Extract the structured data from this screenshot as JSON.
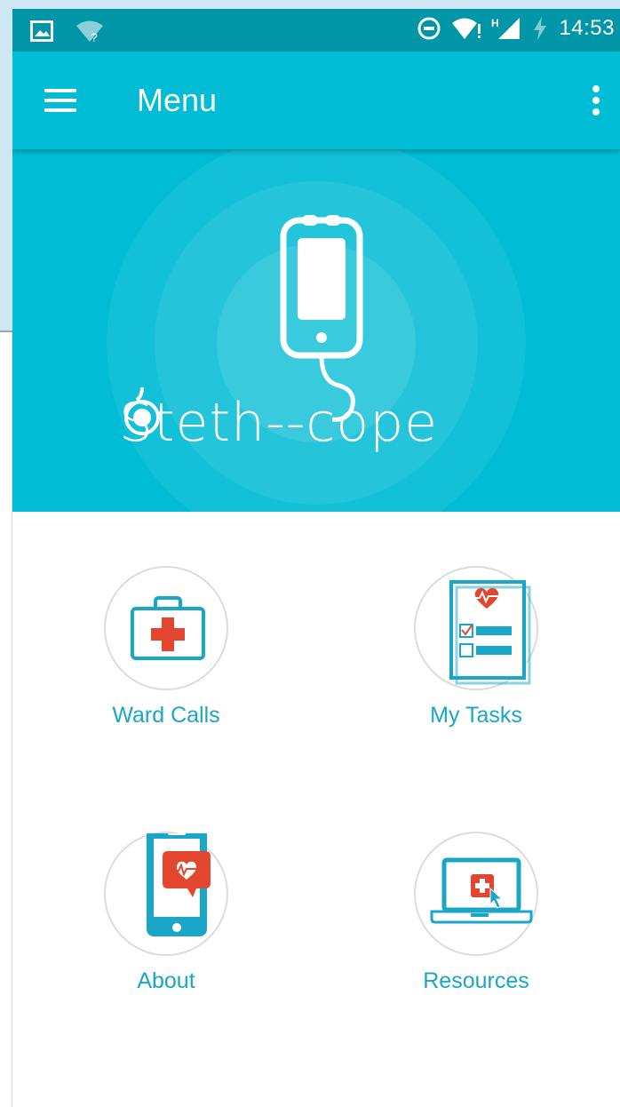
{
  "status_bar": {
    "time": "14:53",
    "icons": [
      "image-icon",
      "wifi-unknown-icon",
      "do-not-disturb-icon",
      "wifi-alert-icon",
      "signal-h-icon",
      "battery-charging-icon"
    ]
  },
  "app_bar": {
    "title": "Menu",
    "icons": [
      "hamburger-menu-icon",
      "overflow-menu-icon"
    ]
  },
  "hero": {
    "logo_text_before": "Steth-",
    "logo_text_after": "-cope"
  },
  "menu": {
    "items": [
      {
        "label": "Ward Calls",
        "icon": "first-aid-kit-icon"
      },
      {
        "label": "My Tasks",
        "icon": "task-checklist-icon"
      },
      {
        "label": "About",
        "icon": "phone-heart-icon"
      },
      {
        "label": "Resources",
        "icon": "laptop-medical-icon"
      }
    ]
  },
  "colors": {
    "primary": "#00bcd4",
    "primary_dark": "#0096a7",
    "accent_red": "#e2462f",
    "label_blue": "#1aa6c7"
  }
}
